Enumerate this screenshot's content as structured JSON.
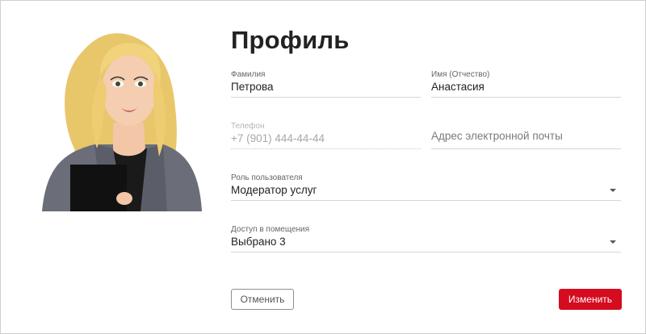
{
  "profile": {
    "title": "Профиль",
    "avatar_icon": "user-avatar-illustration"
  },
  "form": {
    "last_name": {
      "label": "Фамилия",
      "value": "Петрова"
    },
    "first_name": {
      "label": "Имя (Отчество)",
      "value": "Анастасия"
    },
    "phone": {
      "label": "Телефон",
      "value": "+7 (901) 444-44-44",
      "disabled": true
    },
    "email": {
      "placeholder": "Адрес электронной почты",
      "value": ""
    },
    "role": {
      "label": "Роль пользователя",
      "value": "Модератор услуг",
      "icon": "chevron-down-icon"
    },
    "access": {
      "label": "Доступ в помещения",
      "value": "Выбрано 3",
      "icon": "chevron-down-icon"
    }
  },
  "actions": {
    "cancel_label": "Отменить",
    "save_label": "Изменить"
  },
  "colors": {
    "accent": "#d50b1f",
    "text": "#222222",
    "border": "#d6d6d6"
  }
}
